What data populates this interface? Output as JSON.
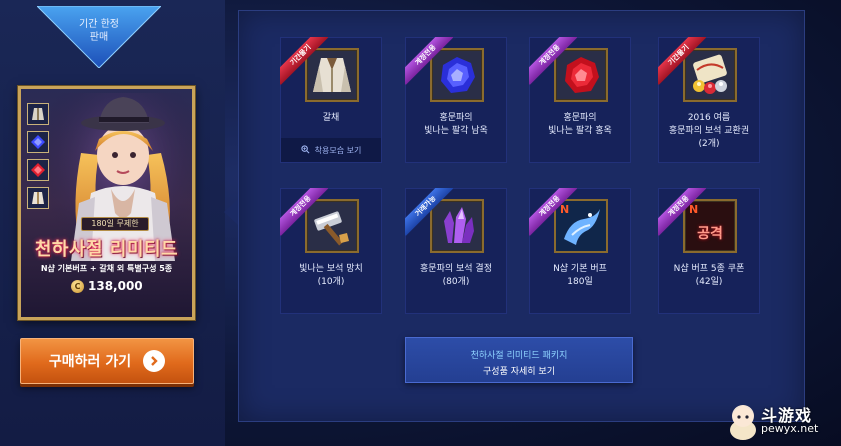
{
  "banner": {
    "line1": "기간 한정",
    "line2": "판매"
  },
  "package": {
    "badge": "180일 무제한",
    "title": "천하사절 리미티드",
    "description": "N샵 기본버프 + 갈채 외 특별구성 5종",
    "price": "138,000",
    "coin_symbol": "C",
    "thumbnails": [
      "coat-icon",
      "sapphire-icon",
      "ruby-icon",
      "coat-icon"
    ]
  },
  "buy_button": {
    "label": "구매하러 가기"
  },
  "items": [
    {
      "ribbon": "기간물기",
      "ribbon_color": "red",
      "icon": "coat-icon",
      "name_line1": "갈채",
      "name_line2": "",
      "name_line3": "",
      "try_on": "착용모습 보기"
    },
    {
      "ribbon": "계정전용",
      "ribbon_color": "purple",
      "icon": "sapphire-icon",
      "name_line1": "홍문파의",
      "name_line2": "빛나는 팔각 남옥",
      "name_line3": ""
    },
    {
      "ribbon": "계정전용",
      "ribbon_color": "purple",
      "icon": "ruby-icon",
      "name_line1": "홍문파의",
      "name_line2": "빛나는 팔각 홍옥",
      "name_line3": ""
    },
    {
      "ribbon": "기간물기",
      "ribbon_color": "red",
      "icon": "gem-voucher-icon",
      "name_line1": "2016 여름",
      "name_line2": "홍문파의 보석 교환권",
      "name_line3": "(2개)"
    },
    {
      "ribbon": "계정전용",
      "ribbon_color": "purple",
      "icon": "hammer-icon",
      "name_line1": "빛나는 보석 망치",
      "name_line2": "(10개)",
      "name_line3": ""
    },
    {
      "ribbon": "거래가능",
      "ribbon_color": "blue",
      "icon": "crystal-icon",
      "name_line1": "홍문파의 보석 결정",
      "name_line2": "(80개)",
      "name_line3": ""
    },
    {
      "ribbon": "계정전용",
      "ribbon_color": "purple",
      "icon": "dragon-buff-icon",
      "name_line1": "N샵 기본 버프",
      "name_line2": "180일",
      "name_line3": ""
    },
    {
      "ribbon": "계정전용",
      "ribbon_color": "purple",
      "icon": "attack-coupon-icon",
      "name_line1": "N샵 버프 5종 쿠폰",
      "name_line2": "(42일)",
      "name_line3": ""
    }
  ],
  "attack_icon_text": "공격",
  "n_logo": "N",
  "detail_button": {
    "line1": "천하사절 리미티드 패키지",
    "line2": "구성품 자세히 보기"
  },
  "watermark": {
    "text1": "斗游戏",
    "text2": "pewyx.net"
  },
  "colors": {
    "ribbon_red": "#c8203a",
    "ribbon_purple": "#9a3cc7",
    "ribbon_blue": "#2a58c7",
    "buy_orange": "#e06a1c",
    "detail_blue": "#2d4da8",
    "gold_border": "#c9a45a"
  }
}
